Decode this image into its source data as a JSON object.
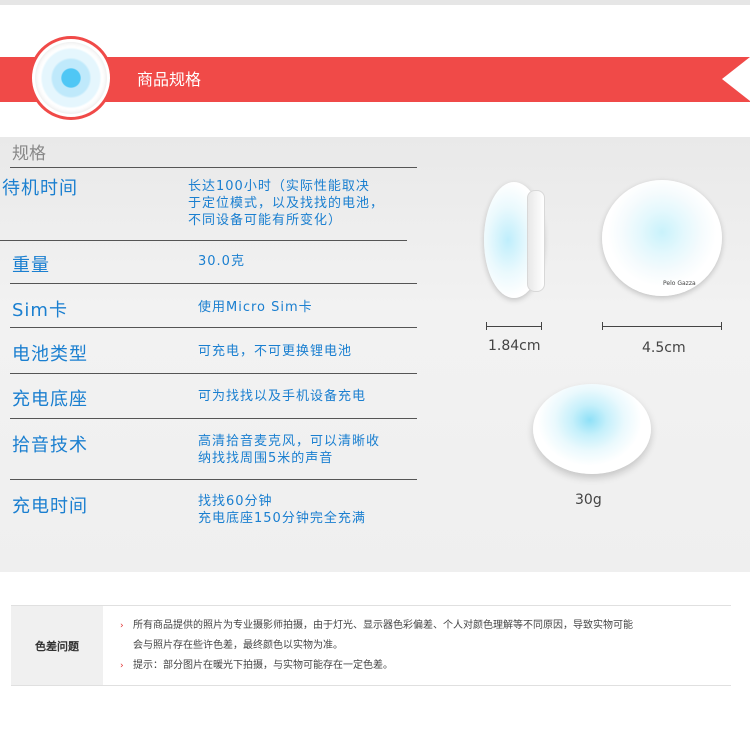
{
  "section": {
    "title": "商品规格"
  },
  "spec": {
    "heading": "规格",
    "rows": [
      {
        "label": "待机时间",
        "value": [
          "长达100小时（实际性能取决",
          "于定位模式，以及找找的电池，",
          "不同设备可能有所变化）"
        ]
      },
      {
        "label": "重量",
        "value": [
          "30.0克"
        ]
      },
      {
        "label": "Sim卡",
        "value": [
          "使用Micro Sim卡"
        ]
      },
      {
        "label": "电池类型",
        "value": [
          "可充电，不可更换锂电池"
        ]
      },
      {
        "label": "充电底座",
        "value": [
          "可为找找以及手机设备充电"
        ]
      },
      {
        "label": "拾音技术",
        "value": [
          "高清拾音麦克风，可以清晰收",
          "纳找找周围5米的声音"
        ]
      },
      {
        "label": "充电时间",
        "value": [
          "找找60分钟",
          "充电底座150分钟完全充满"
        ]
      }
    ]
  },
  "dimensions": {
    "thickness": "1.84cm",
    "diameter": "4.5cm",
    "weight": "30g",
    "brand_print": "Pelo Gazza"
  },
  "notice": {
    "label": "色差问题",
    "lines": [
      "所有商品提供的照片为专业摄影师拍摄，由于灯光、显示器色彩偏差、个人对颜色理解等不同原因，导致实物可能",
      "会与照片存在些许色差，最终颜色以实物为准。",
      "提示：部分图片在暖光下拍摄，与实物可能存在一定色差。"
    ],
    "bullet_rows": [
      0,
      2
    ]
  },
  "colors": {
    "banner": "#f04a48",
    "spec_text": "#1a7fd0",
    "bullet": "#e03030"
  }
}
